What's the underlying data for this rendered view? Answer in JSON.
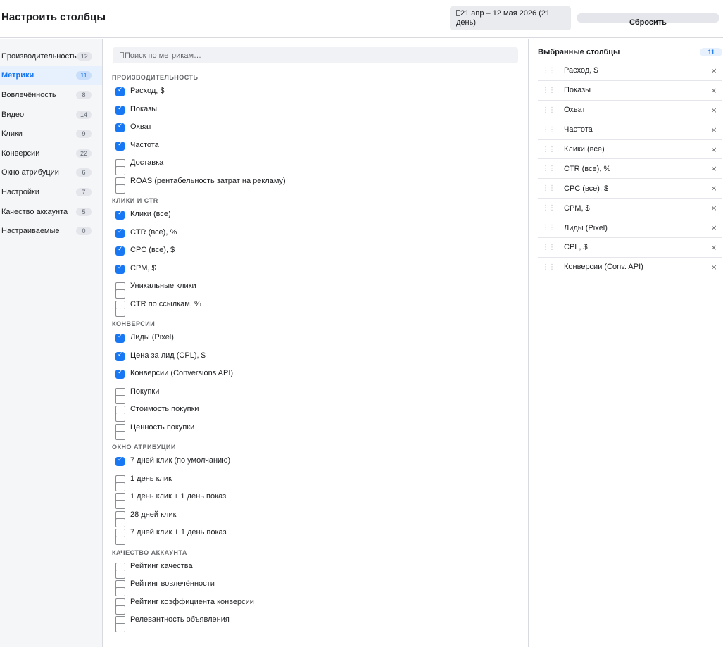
{
  "header": {
    "title": "Настроить столбцы",
    "date_range": "21 апр – 12 мая 2026 (21 день)",
    "reset_label": "Сбросить"
  },
  "sidebar": {
    "items": [
      {
        "label": "Производительность",
        "count": "12",
        "active": false
      },
      {
        "label": "Метрики",
        "count": "11",
        "active": true
      },
      {
        "label": "Вовлечённость",
        "count": "8",
        "active": false
      },
      {
        "label": "Видео",
        "count": "14",
        "active": false
      },
      {
        "label": "Клики",
        "count": "9",
        "active": false
      },
      {
        "label": "Конверсии",
        "count": "22",
        "active": false
      },
      {
        "label": "Окно атрибуции",
        "count": "6",
        "active": false
      },
      {
        "label": "Настройки",
        "count": "7",
        "active": false
      },
      {
        "label": "Качество аккаунта",
        "count": "5",
        "active": false
      },
      {
        "label": "Настраиваемые",
        "count": "0",
        "active": false
      }
    ]
  },
  "search": {
    "placeholder": "Поиск по метрикам…",
    "value": ""
  },
  "sections": [
    {
      "title": "Производительность",
      "items": [
        {
          "label": "Расход, $",
          "checked": true
        },
        {
          "label": "Показы",
          "checked": true
        },
        {
          "label": "Охват",
          "checked": true
        },
        {
          "label": "Частота",
          "checked": true
        },
        {
          "label": "Доставка",
          "checked": false
        },
        {
          "label": "ROAS (рентабельность затрат на рекламу)",
          "checked": false
        }
      ]
    },
    {
      "title": "Клики и CTR",
      "items": [
        {
          "label": "Клики (все)",
          "checked": true
        },
        {
          "label": "CTR (все), %",
          "checked": true
        },
        {
          "label": "CPC (все), $",
          "checked": true
        },
        {
          "label": "CPM, $",
          "checked": true
        },
        {
          "label": "Уникальные клики",
          "checked": false
        },
        {
          "label": "CTR по ссылкам, %",
          "checked": false
        }
      ]
    },
    {
      "title": "Конверсии",
      "items": [
        {
          "label": "Лиды (Pixel)",
          "checked": true
        },
        {
          "label": "Цена за лид (CPL), $",
          "checked": true
        },
        {
          "label": "Конверсии (Conversions API)",
          "checked": true
        },
        {
          "label": "Покупки",
          "checked": false
        },
        {
          "label": "Стоимость покупки",
          "checked": false
        },
        {
          "label": "Ценность покупки",
          "checked": false
        }
      ]
    },
    {
      "title": "Окно атрибуции",
      "items": [
        {
          "label": "7 дней клик (по умолчанию)",
          "checked": true
        },
        {
          "label": "1 день клик",
          "checked": false
        },
        {
          "label": "1 день клик + 1 день показ",
          "checked": false
        },
        {
          "label": "28 дней клик",
          "checked": false
        },
        {
          "label": "7 дней клик + 1 день показ",
          "checked": false
        }
      ]
    },
    {
      "title": "Качество аккаунта",
      "items": [
        {
          "label": "Рейтинг качества",
          "checked": false
        },
        {
          "label": "Рейтинг вовлечённости",
          "checked": false
        },
        {
          "label": "Рейтинг коэффициента конверсии",
          "checked": false
        },
        {
          "label": "Релевантность объявления",
          "checked": false
        }
      ]
    }
  ],
  "selected": {
    "title": "Выбранные столбцы",
    "count": "11",
    "items": [
      "Расход, $",
      "Показы",
      "Охват",
      "Частота",
      "Клики (все)",
      "CTR (все), %",
      "CPC (все), $",
      "CPM, $",
      "Лиды (Pixel)",
      "CPL, $",
      "Конверсии (Conv. API)"
    ],
    "drag_glyph": "⋮⋮",
    "remove_glyph": "×"
  },
  "colors": {
    "accent": "#1877f2",
    "active_bg": "#e7f0fd",
    "sidebar_bg": "#f5f6f7"
  }
}
